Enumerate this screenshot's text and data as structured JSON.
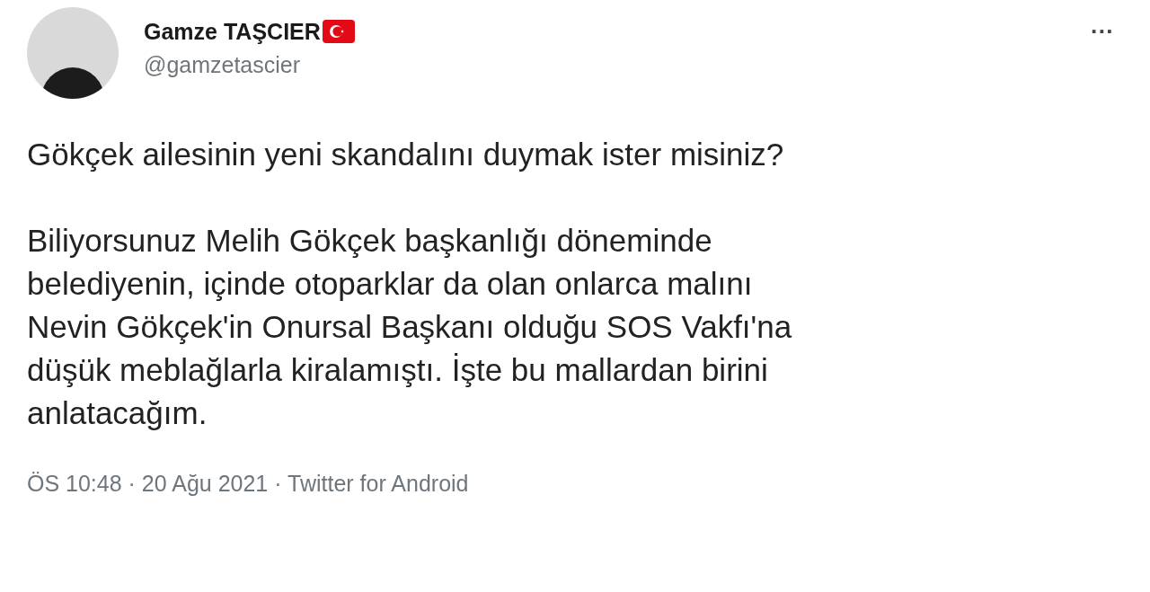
{
  "author": {
    "name": "Gamze TAŞCIER",
    "handle": "@gamzetascier"
  },
  "menu": {
    "label": "···"
  },
  "paragraphs": [
    {
      "lines": [
        "Gökçek ailesinin yeni skandalını duymak ister misiniz?"
      ]
    },
    {
      "lines": [
        "Biliyorsunuz Melih Gökçek başkanlığı döneminde",
        "belediyenin, içinde otoparklar da olan onlarca malını",
        "Nevin Gökçek'in Onursal Başkanı olduğu SOS Vakfı'na",
        "düşük meblağlarla kiralamıştı. İşte bu mallardan birini",
        "anlatacağım."
      ]
    }
  ],
  "footer": "ÖS 10:48 · 20 Ağu 2021 · Twitter for Android"
}
